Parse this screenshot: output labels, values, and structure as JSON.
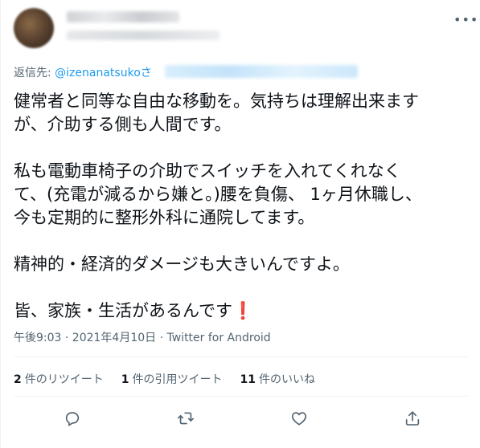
{
  "header": {
    "more_label": "•••"
  },
  "reply_to": {
    "prefix": "返信先: ",
    "mention": "@izenanatsuko",
    "suffix": "さ"
  },
  "body": {
    "lines": [
      "健常者と同等な自由な移動を。気持ちは理解出来ます",
      "が、介助する側も人間です。",
      "私も電動車椅子の介助でスイッチを入れてくれなく",
      "て、(充電が減るから嫌と。)腰を負傷、 1ヶ月休職し、",
      "今も定期的に整形外科に通院してます。",
      "精神的・経済的ダメージも大きいんですよ。",
      "皆、家族・生活があるんです",
      "❗"
    ]
  },
  "meta": {
    "text": "午後9:03 · 2021年4月10日 · Twitter for Android"
  },
  "stats": {
    "retweets_num": "2",
    "retweets_label": "件のリツイート",
    "quotes_num": "1",
    "quotes_label": "件の引用ツイート",
    "likes_num": "11",
    "likes_label": "件のいいね"
  },
  "icons": {
    "reply": "reply-icon",
    "retweet": "retweet-icon",
    "like": "heart-icon",
    "share": "share-icon"
  },
  "colors": {
    "accent": "#1d9bf0",
    "text": "#0f1419",
    "secondary": "#536471",
    "exclamation": "#e0245e"
  }
}
